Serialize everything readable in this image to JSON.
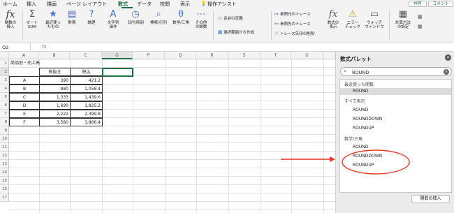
{
  "menu": {
    "tabs": [
      "ホーム",
      "挿入",
      "描画",
      "ページ レイアウト",
      "数式",
      "データ",
      "校閲",
      "表示"
    ],
    "active_tab": "数式",
    "tell_me": "操作アシスト",
    "share": "共有",
    "comment": "コメント"
  },
  "ribbon": {
    "insert_function": "関数の\n挿入",
    "autosum": "オート\nSUM",
    "recent": "最近使っ\nたもの",
    "financial": "財務",
    "logical": "論理",
    "text": "文字列\n操作",
    "datetime": "日付/時刻",
    "lookup": "検索/行列",
    "math": "数学/三角",
    "more": "その他\nの関数",
    "define_name": "名前の定義",
    "create_from_selection": "選択範囲から作成",
    "trace_precedents": "参照元のトレース",
    "trace_dependents": "参照先のトレース",
    "remove_arrows": "トレース矢印の削除",
    "show_formulas": "数式の\n表示",
    "error_checking": "エラー\nチェック",
    "watch_window": "ウォッチ\nウィンドウ",
    "calc_options": "計算方法\nの設定"
  },
  "formula_bar": {
    "name_box": "O2",
    "fx": "fx",
    "value": ""
  },
  "sheet": {
    "columns": [
      "A",
      "B",
      "C",
      "O",
      "P",
      "Q",
      "R",
      "S",
      "T",
      "U"
    ],
    "rows": [
      "1",
      "2",
      "3",
      "4",
      "5",
      "6",
      "7",
      "8",
      "9",
      "10",
      "11",
      "12",
      "13",
      "14",
      "15",
      "16",
      "17"
    ],
    "title": "商品別・売上高",
    "header_b": "税抜き",
    "header_c": "税込",
    "data": [
      [
        "A",
        "390",
        "421.2"
      ],
      [
        "B",
        "980",
        "1,058.4"
      ],
      [
        "C",
        "1,333",
        "1,439.6"
      ],
      [
        "D",
        "1,690",
        "1,825.2"
      ],
      [
        "E",
        "2,222",
        "2,399.8"
      ],
      [
        "F",
        "3,580",
        "3,866.4"
      ]
    ]
  },
  "pane": {
    "title": "数式パレット",
    "search_value": "ROUND",
    "categories": [
      {
        "name": "最近使った関数",
        "items": [
          "ROUND"
        ]
      },
      {
        "name": "すべて表示",
        "items": [
          "ROUND",
          "ROUNDDOWN",
          "ROUNDUP"
        ]
      },
      {
        "name": "数学/三角",
        "items": [
          "ROUND",
          "ROUNDDOWN",
          "ROUNDUP"
        ]
      }
    ],
    "insert_button": "関数の挿入"
  },
  "colors": {
    "accent": "#1e7145",
    "annotation": "#e8392a"
  }
}
